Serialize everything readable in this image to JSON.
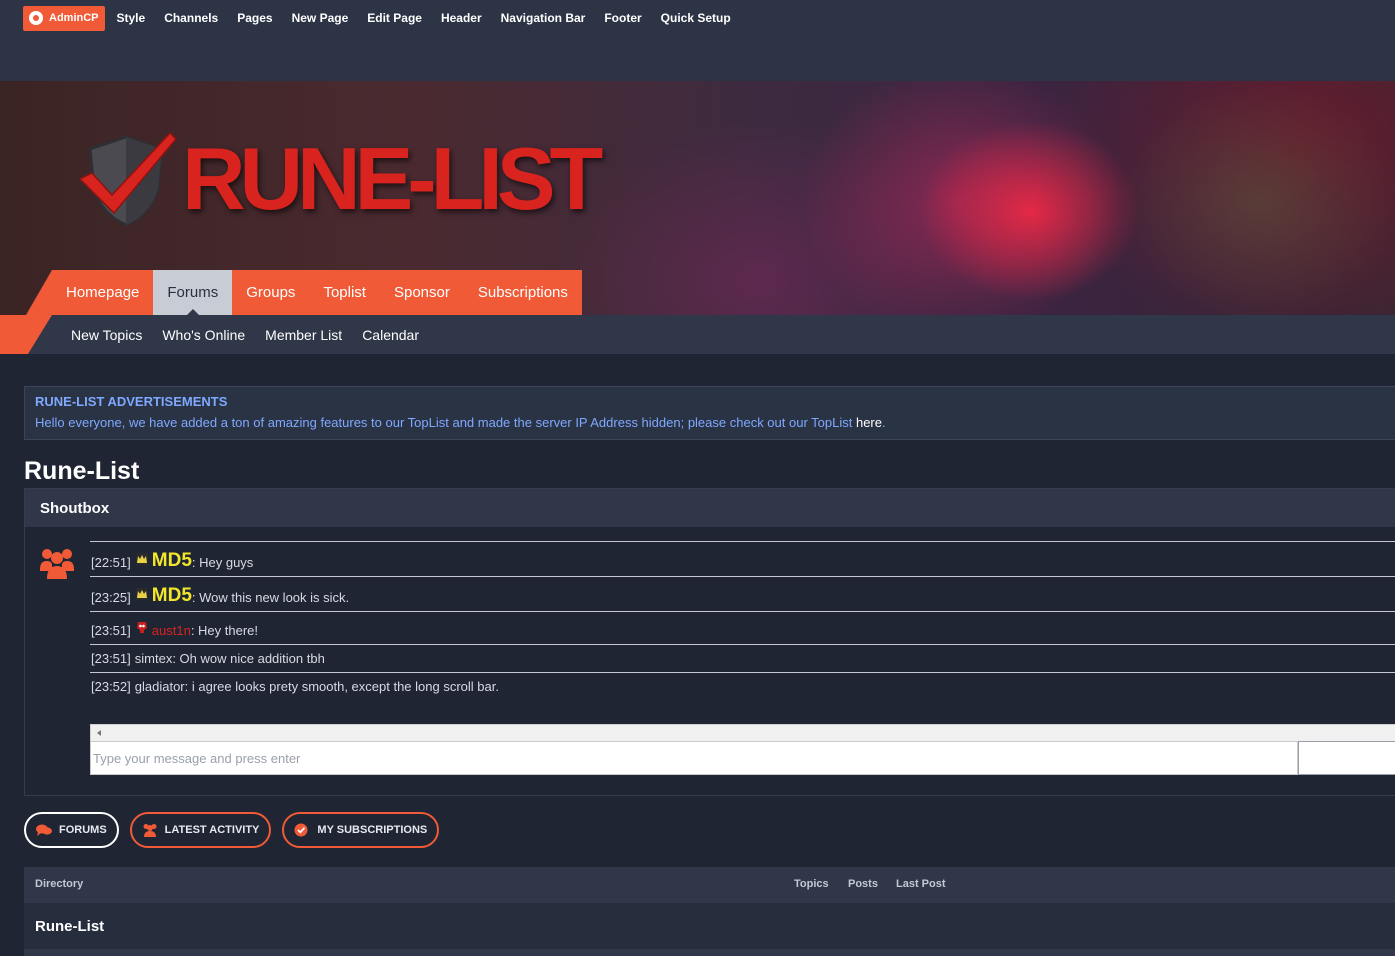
{
  "adminbar": {
    "admincp_label": "AdminCP",
    "links": [
      "Style",
      "Channels",
      "Pages",
      "New Page",
      "Edit Page",
      "Header",
      "Navigation Bar",
      "Footer",
      "Quick Setup"
    ]
  },
  "header": {
    "logo_text": "RUNE-LIST"
  },
  "main_nav": {
    "tabs": [
      {
        "label": "Homepage"
      },
      {
        "label": "Forums"
      },
      {
        "label": "Groups"
      },
      {
        "label": "Toplist"
      },
      {
        "label": "Sponsor"
      },
      {
        "label": "Subscriptions"
      }
    ],
    "active": "Forums"
  },
  "sub_nav": {
    "items": [
      "New Topics",
      "Who's Online",
      "Member List",
      "Calendar"
    ]
  },
  "notice": {
    "title": "RUNE-LIST ADVERTISEMENTS",
    "message": "Hello everyone, we have added a ton of amazing features to our TopList and made the server IP Address hidden; please check out our TopList ",
    "link_text": "here",
    "trailing": "."
  },
  "page_title": "Rune-List",
  "shoutbox": {
    "title": "Shoutbox",
    "shouts": [
      {
        "time": "[22:51]",
        "user": "MD5",
        "message": ": Hey guys"
      },
      {
        "time": "[23:25]",
        "user": "MD5",
        "message": ": Wow this new look is sick."
      },
      {
        "time": "[23:51]",
        "user": "aust1n",
        "message": ": Hey there!"
      },
      {
        "time": "[23:51]",
        "user": "simtex",
        "message": ": Oh wow nice addition tbh"
      },
      {
        "time": "[23:52]",
        "user": "gladiator",
        "message": ": i agree looks prety smooth, except the long scroll bar."
      }
    ],
    "input_placeholder": "Type your message and press enter"
  },
  "tabs": {
    "forums": "FORUMS",
    "latest_activity": "LATEST ACTIVITY",
    "my_subscriptions": "MY SUBSCRIPTIONS"
  },
  "forum_table": {
    "headers": {
      "directory": "Directory",
      "topics": "Topics",
      "posts": "Posts",
      "last_post": "Last Post"
    },
    "category": "Rune-List"
  },
  "colors": {
    "accent": "#f05a36",
    "md5_user": "#f2e62a",
    "aust1n_user": "#d8231e",
    "notice_text": "#7fa8ff"
  }
}
